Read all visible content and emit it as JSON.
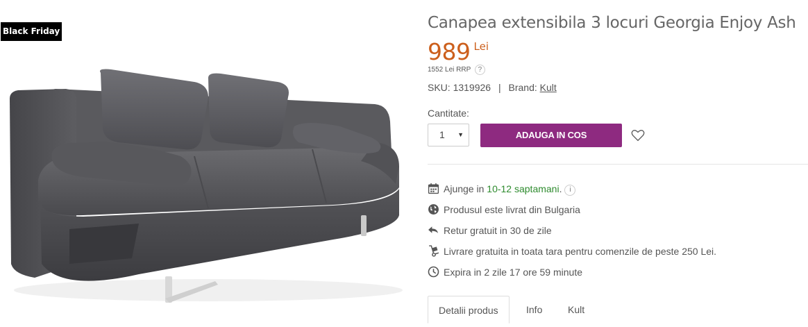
{
  "badge": "Black Friday",
  "product": {
    "title": "Canapea extensibila 3 locuri Georgia Enjoy Ash",
    "price": "989",
    "currency": "Lei",
    "rrp_text": "1552 Lei RRP",
    "rrp_help": "?",
    "sku_label": "SKU:",
    "sku_value": "1319926",
    "separator": "|",
    "brand_label": "Brand:",
    "brand_value": "Kult"
  },
  "purchase": {
    "qty_label": "Cantitate:",
    "qty_value": "1",
    "add_to_cart": "ADAUGA IN COS"
  },
  "features": {
    "delivery_prefix": "Ajunge in ",
    "delivery_time": "10-12 saptamani",
    "delivery_suffix": ".",
    "delivery_info": "i",
    "origin": "Produsul este livrat din Bulgaria",
    "returns": "Retur gratuit in 30 de zile",
    "shipping": "Livrare gratuita in toata tara pentru comenzile de peste 250 Lei.",
    "expires": "Expira in 2 zile 17 ore 59 minute"
  },
  "tabs": [
    "Detalii produs",
    "Info",
    "Kult"
  ],
  "colors": {
    "accent": "#8e2a80",
    "price": "#cc5f1c",
    "green": "#2e8b2e"
  }
}
